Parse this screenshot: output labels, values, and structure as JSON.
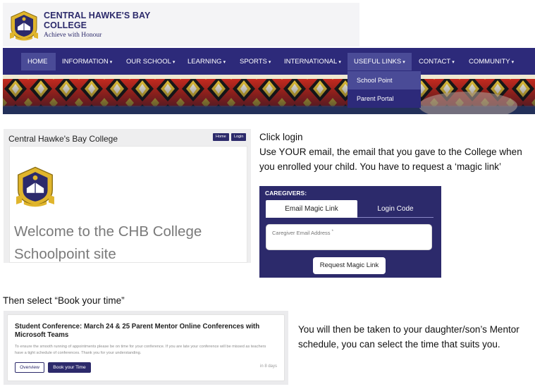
{
  "header": {
    "school_name": "CENTRAL HAWKE'S BAY COLLEGE",
    "motto": "Achieve with Honour"
  },
  "nav": {
    "items": [
      {
        "label": "HOME",
        "caret": ""
      },
      {
        "label": "INFORMATION",
        "caret": "▾"
      },
      {
        "label": "OUR SCHOOL",
        "caret": "▾"
      },
      {
        "label": "LEARNING",
        "caret": "▾"
      },
      {
        "label": "SPORTS",
        "caret": "▾"
      },
      {
        "label": "INTERNATIONAL",
        "caret": "▾"
      },
      {
        "label": "USEFUL LINKS",
        "caret": "▾"
      },
      {
        "label": "CONTACT",
        "caret": "▾"
      },
      {
        "label": "COMMUNITY",
        "caret": "▾"
      }
    ],
    "active": "HOME",
    "open_menu": "USEFUL LINKS",
    "dropdown": [
      "School Point",
      "Parent Portal"
    ]
  },
  "schoolpoint": {
    "title": "Central Hawke's Bay College",
    "home_button": "Home",
    "login_button": "Login",
    "welcome": "Welcome to the CHB College Schoolpoint site"
  },
  "instructions": {
    "click_login": "Click login",
    "use_email": "Use YOUR email, the email that you gave to the College when you enrolled your child. You have to request a ‘magic link’",
    "then_select": "Then select “Book your time”",
    "taken_to": "You will then be taken to your daughter/son’s Mentor schedule, you can select the time that suits you."
  },
  "caregiver_login": {
    "heading": "CAREGIVERS:",
    "tabs": [
      "Email Magic Link",
      "Login Code"
    ],
    "active_tab": "Email Magic Link",
    "email_placeholder": "Caregiver Email Address",
    "required_mark": "*",
    "email_value": "",
    "submit_label": "Request Magic Link"
  },
  "conference": {
    "title": "Student Conference: March 24 & 25 Parent Mentor Online Conferences with Microsoft Teams",
    "description": "To ensure the smooth running of appointments please be on time for your conference. If you are late your conference will be missed as teachers have a tight schedule of conferences.  Thank you for your understanding.",
    "overview_label": "Overview",
    "book_label": "Book your Time",
    "due": "in 8 days"
  },
  "colors": {
    "brand_navy": "#2c2a6b",
    "nav_bg": "#2d2a7a",
    "nav_active": "#4a4b97",
    "crest_gold": "#e0b52c"
  }
}
